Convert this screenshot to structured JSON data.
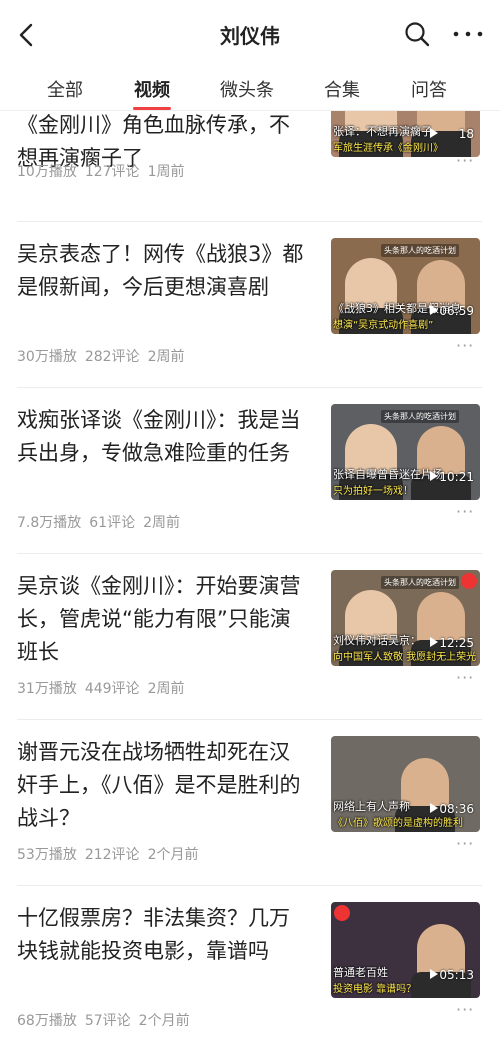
{
  "header": {
    "title": "刘仪伟",
    "back_icon": "chevron-left-icon",
    "search_icon": "search-icon",
    "more_icon": "more-dots-icon"
  },
  "tabs": [
    {
      "label": "全部"
    },
    {
      "label": "视频"
    },
    {
      "label": "微头条"
    },
    {
      "label": "合集"
    },
    {
      "label": "问答"
    }
  ],
  "active_tab": "视频",
  "accent_color": "#f04142",
  "items": [
    {
      "title": "《金刚川》角色血脉传承，不想再演瘸子了",
      "plays": "10万播放",
      "comments": "127评论",
      "time": "1周前",
      "thumb_text": "张译：不想再演瘸子",
      "thumb_text2": "军旅生涯传承《金刚川》",
      "duration": "18",
      "thumb_bg": "#a9826b"
    },
    {
      "title": "吴京表态了！网传《战狼3》都是假新闻，今后更想演喜剧",
      "plays": "30万播放",
      "comments": "282评论",
      "time": "2周前",
      "thumb_text": "《战狼3》相关都是假消息",
      "thumb_text2": "想演“吴京式动作喜剧”",
      "duration": "06:59",
      "badge": "头条那人的吃酒计划",
      "thumb_bg": "#8a6b4e"
    },
    {
      "title": "戏痴张译谈《金刚川》：我是当兵出身，专做急难险重的任务",
      "plays": "7.8万播放",
      "comments": "61评论",
      "time": "2周前",
      "thumb_text": "张译自曝曾昏迷在片场",
      "thumb_text2": "只为拍好一场戏！",
      "duration": "10:21",
      "badge": "头条那人的吃酒计划",
      "thumb_bg": "#5d5f63"
    },
    {
      "title": "吴京谈《金刚川》：开始要演营长，管虎说“能力有限”只能演班长",
      "plays": "31万播放",
      "comments": "449评论",
      "time": "2周前",
      "thumb_text": "刘仪伟对话吴京：",
      "thumb_text2": "向中国军人致敬 我愿封无上荣光",
      "duration": "12:25",
      "badge": "头条那人的吃酒计划",
      "thumb_bg": "#7b6a58"
    },
    {
      "title": "谢晋元没在战场牺牲却死在汉奸手上，《八佰》是不是胜利的战斗？",
      "plays": "53万播放",
      "comments": "212评论",
      "time": "2个月前",
      "thumb_text": "网络上有人声称",
      "thumb_text2": "《八佰》歌颂的是虚构的胜利",
      "duration": "08:36",
      "thumb_bg": "#6f6a63"
    },
    {
      "title": "十亿假票房？非法集资？几万块钱就能投资电影，靠谱吗",
      "plays": "68万播放",
      "comments": "57评论",
      "time": "2个月前",
      "thumb_text": "普通老百姓",
      "thumb_text2": "投资电影 靠谱吗？",
      "duration": "05:13",
      "thumb_bg": "#3d3140"
    }
  ]
}
